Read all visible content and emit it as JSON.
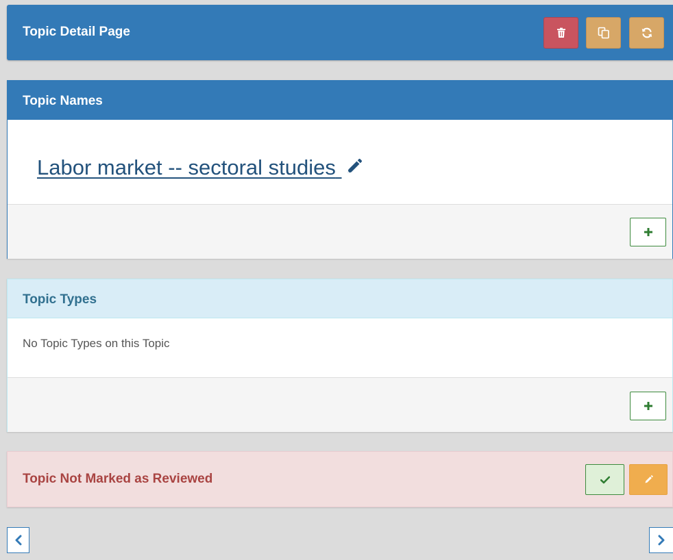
{
  "header": {
    "title": "Topic Detail Page",
    "buttons": [
      {
        "icon": "trash-icon",
        "color": "#c9545f"
      },
      {
        "icon": "copy-icon",
        "color": "#d7a767"
      },
      {
        "icon": "refresh-icon",
        "color": "#d7a767"
      }
    ]
  },
  "names": {
    "title": "Topic Names",
    "topic_name": "Labor market -- sectoral studies",
    "add_icon": "plus-icon"
  },
  "types": {
    "title": "Topic Types",
    "empty_text": "No Topic Types on this Topic",
    "add_icon": "plus-icon"
  },
  "review": {
    "status_text": "Topic Not Marked as Reviewed",
    "approve_icon": "check-icon",
    "edit_icon": "pencil-icon"
  },
  "pager": {
    "prev_icon": "chevron-left-icon",
    "next_icon": "chevron-right-icon"
  },
  "colors": {
    "primary": "#337ab7",
    "danger": "#c9545f",
    "warning": "#d7a767",
    "info_bg": "#d9edf7",
    "danger_bg": "#f2dede",
    "success": "#3c8a3c"
  }
}
